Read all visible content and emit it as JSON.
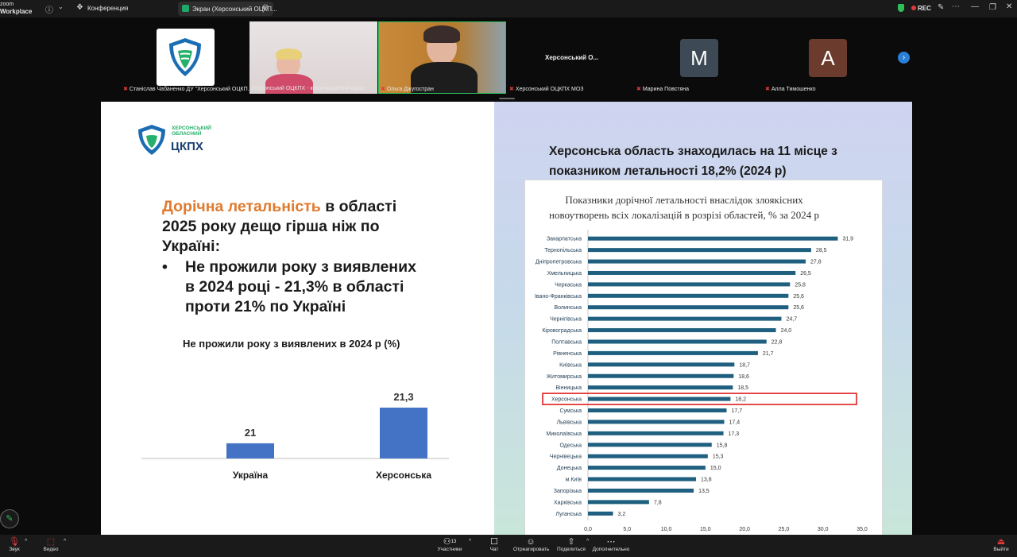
{
  "app": {
    "brand_line1": "zoom",
    "brand_line2": "Workplace"
  },
  "topbar": {
    "meeting_tab": "Конференция",
    "screen_tab": "Экран (Херсонський ОЦКП...",
    "rec_label": "REC"
  },
  "participants": [
    {
      "name": "Станіслав Чабаненко ДУ \"Херсонський ОЦКП...",
      "muted": true
    },
    {
      "name": "Херсонський ОЦКПХ - комунікаційний відділ",
      "muted": false
    },
    {
      "name": "Ольга Джугостран",
      "muted": true
    },
    {
      "name": "Херсонський ОЦКПХ МОЗ",
      "muted": true,
      "tile_text": "Херсонський О..."
    },
    {
      "name": "Марина Повстяна",
      "muted": true,
      "initial": "M",
      "color": "#3d4a55"
    },
    {
      "name": "Алла Тимошенко",
      "muted": true,
      "initial": "A",
      "color": "#6b3b2e"
    }
  ],
  "slide": {
    "logo": {
      "line1": "ХЕРСОНСЬКИЙ",
      "line2": "ОБЛАСНИЙ",
      "line3": "ЦКПХ"
    },
    "heading_highlight": "Дорічна летальність",
    "heading_line1_rest": " в області",
    "heading_line2": "2025 року дещо гірша  ніж по",
    "heading_line3": "Україні:",
    "bullet": "•",
    "bullet_line1": "Не прожили року з виявлених",
    "bullet_line2": "в 2024 році  - 21,3% в області",
    "bullet_line3": "проти 21% по Україні",
    "right_title_line1": "Херсонська область знаходилась на 11 місце з",
    "right_title_line2": "показником  летальності 18,2% (2024 р)"
  },
  "chart_data": [
    {
      "type": "bar",
      "title": "Не прожили року з виявлених в 2024 р (%)",
      "categories": [
        "Україна",
        "Херсонська"
      ],
      "values": [
        21,
        21.3
      ],
      "value_labels": [
        "21",
        "21,3"
      ],
      "color": "#4472c4"
    },
    {
      "type": "bar",
      "orientation": "horizontal",
      "title_line1": "Показники дорічної летальності внаслідок злоякісних",
      "title_line2": "новоутворень всіх локалізацій в розрізі областей, % за 2024 р",
      "categories": [
        "Закарпатська",
        "Тернопільська",
        "Дніпропетровська",
        "Хмельницька",
        "Черкаська",
        "Івано-Франківська",
        "Волинська",
        "Чернігівська",
        "Кіровоградська",
        "Полтавська",
        "Рівненська",
        "Київська",
        "Житомирська",
        "Вінницька",
        "Херсонська",
        "Сумська",
        "Львівська",
        "Миколаївська",
        "Одеська",
        "Чернівецька",
        "Донецька",
        "м.Київ",
        "Запорізька",
        "Харківська",
        "Луганська"
      ],
      "values": [
        31.9,
        28.5,
        27.8,
        26.5,
        25.8,
        25.6,
        25.6,
        24.7,
        24.0,
        22.8,
        21.7,
        18.7,
        18.6,
        18.5,
        18.2,
        17.7,
        17.4,
        17.3,
        15.8,
        15.3,
        15.0,
        13.8,
        13.5,
        7.8,
        3.2
      ],
      "value_labels": [
        "31,9",
        "28,5",
        "27,8",
        "26,5",
        "25,8",
        "25,6",
        "25,6",
        "24,7",
        "24,0",
        "22,8",
        "21,7",
        "18,7",
        "18,6",
        "18,5",
        "18,2",
        "17,7",
        "17,4",
        "17,3",
        "15,8",
        "15,3",
        "15,0",
        "13,8",
        "13,5",
        "7,8",
        "3,2"
      ],
      "highlight": "Херсонська",
      "xlim": [
        0,
        35
      ],
      "xticks": [
        "0,0",
        "5,0",
        "10,0",
        "15,0",
        "20,0",
        "25,0",
        "30,0",
        "35,0"
      ],
      "color": "#1f5f7f",
      "highlight_color": "#e02020"
    }
  ],
  "bottombar": {
    "audio": "Звук",
    "video": "Видео",
    "participants": "Участники",
    "participants_count": "13",
    "chat": "Чат",
    "react": "Отреагировать",
    "share": "Поделиться",
    "more": "Дополнительно",
    "leave": "Выйти"
  }
}
